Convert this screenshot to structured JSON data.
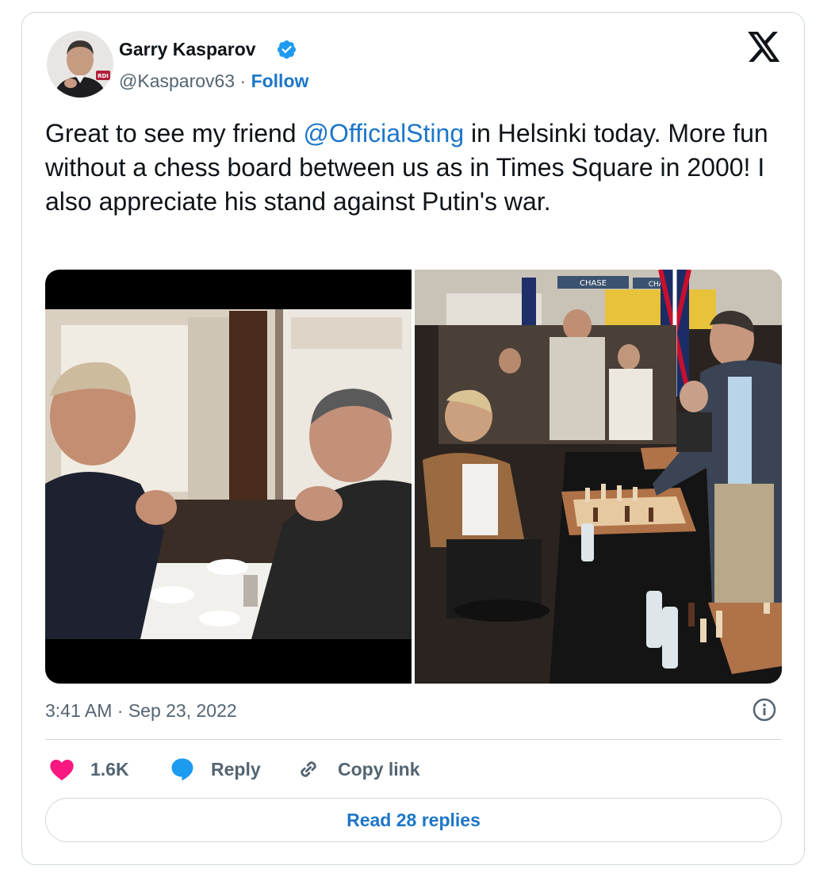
{
  "author": {
    "display_name": "Garry Kasparov",
    "handle": "@Kasparov63",
    "separator": "·",
    "follow_label": "Follow",
    "avatar_badge_text": "RDI"
  },
  "tweet": {
    "text_before": "Great to see my friend ",
    "mention": "@OfficialSting",
    "text_after": " in Helsinki today. More fun without a chess board between us as in Times Square in 2000! I also appreciate his stand against Putin's war.",
    "timestamp": "3:41 AM · Sep 23, 2022"
  },
  "media": {
    "photos": [
      {
        "name": "cafe-photo",
        "signs": []
      },
      {
        "name": "times-square-chess-photo",
        "signs": [
          "CHASE",
          "CHASE"
        ]
      }
    ]
  },
  "actions": {
    "likes_count": "1.6K",
    "reply_label": "Reply",
    "copy_link_label": "Copy link"
  },
  "read_replies_label": "Read 28 replies",
  "colors": {
    "link": "#1d76c9",
    "verified": "#1d9bf0",
    "heart": "#f91880",
    "secondary_text": "#536471",
    "border": "#cfd9de"
  },
  "icons": [
    "verified-badge-icon",
    "x-logo-icon",
    "info-icon",
    "heart-icon",
    "reply-bubble-icon",
    "link-icon"
  ]
}
